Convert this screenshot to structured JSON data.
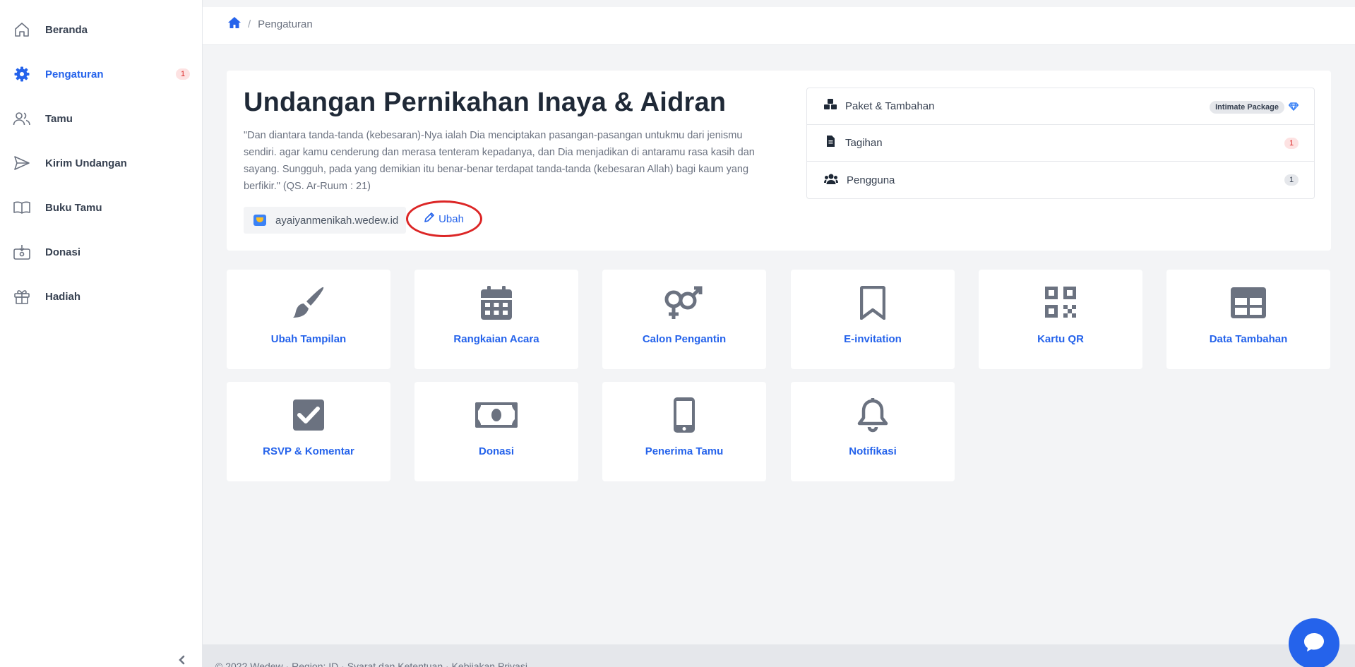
{
  "sidebar": {
    "items": [
      {
        "label": "Beranda",
        "icon": "home-icon"
      },
      {
        "label": "Pengaturan",
        "icon": "gear-icon",
        "badge": "1",
        "active": true
      },
      {
        "label": "Tamu",
        "icon": "users-icon"
      },
      {
        "label": "Kirim Undangan",
        "icon": "send-icon"
      },
      {
        "label": "Buku Tamu",
        "icon": "book-icon"
      },
      {
        "label": "Donasi",
        "icon": "donation-icon"
      },
      {
        "label": "Hadiah",
        "icon": "gift-icon"
      }
    ]
  },
  "breadcrumb": {
    "home_icon": "home-icon",
    "current": "Pengaturan"
  },
  "header": {
    "title": "Undangan Pernikahan Inaya & Aidran",
    "quote": "\"Dan diantara tanda-tanda (kebesaran)-Nya ialah Dia menciptakan pasangan-pasangan untukmu dari jenismu sendiri. agar kamu cenderung dan merasa tenteram kepadanya, dan Dia menjadikan di antaramu rasa kasih dan sayang. Sungguh, pada yang demikian itu benar-benar terdapat tanda-tanda (kebesaran Allah) bagi kaum yang berfikir.\" (QS. Ar-Ruum : 21)",
    "domain": "ayaiyanmenikah.wedew.id",
    "edit_label": "Ubah"
  },
  "side_list": [
    {
      "label": "Paket & Tambahan",
      "icon": "boxes-icon",
      "badge": "Intimate Package"
    },
    {
      "label": "Tagihan",
      "icon": "invoice-icon",
      "badge": "1"
    },
    {
      "label": "Pengguna",
      "icon": "user-group-icon",
      "badge": "1"
    }
  ],
  "tiles": [
    {
      "label": "Ubah Tampilan",
      "icon": "paint-brush-icon"
    },
    {
      "label": "Rangkaian Acara",
      "icon": "calendar-icon"
    },
    {
      "label": "Calon Pengantin",
      "icon": "gender-icon"
    },
    {
      "label": "E-invitation",
      "icon": "bookmark-icon"
    },
    {
      "label": "Kartu QR",
      "icon": "qr-code-icon"
    },
    {
      "label": "Data Tambahan",
      "icon": "table-icon"
    },
    {
      "label": "RSVP & Komentar",
      "icon": "check-square-icon"
    },
    {
      "label": "Donasi",
      "icon": "money-bill-icon"
    },
    {
      "label": "Penerima Tamu",
      "icon": "mobile-icon"
    },
    {
      "label": "Notifikasi",
      "icon": "bell-icon"
    }
  ],
  "footer": {
    "text": "© 2022 Wedew · Region: ID · Syarat dan Ketentuan · Kebijakan Privasi"
  },
  "colors": {
    "accent": "#2563eb",
    "icon_gray": "#6b7280",
    "badge_red": "#dc2626",
    "highlight_ring": "#dc2626"
  }
}
